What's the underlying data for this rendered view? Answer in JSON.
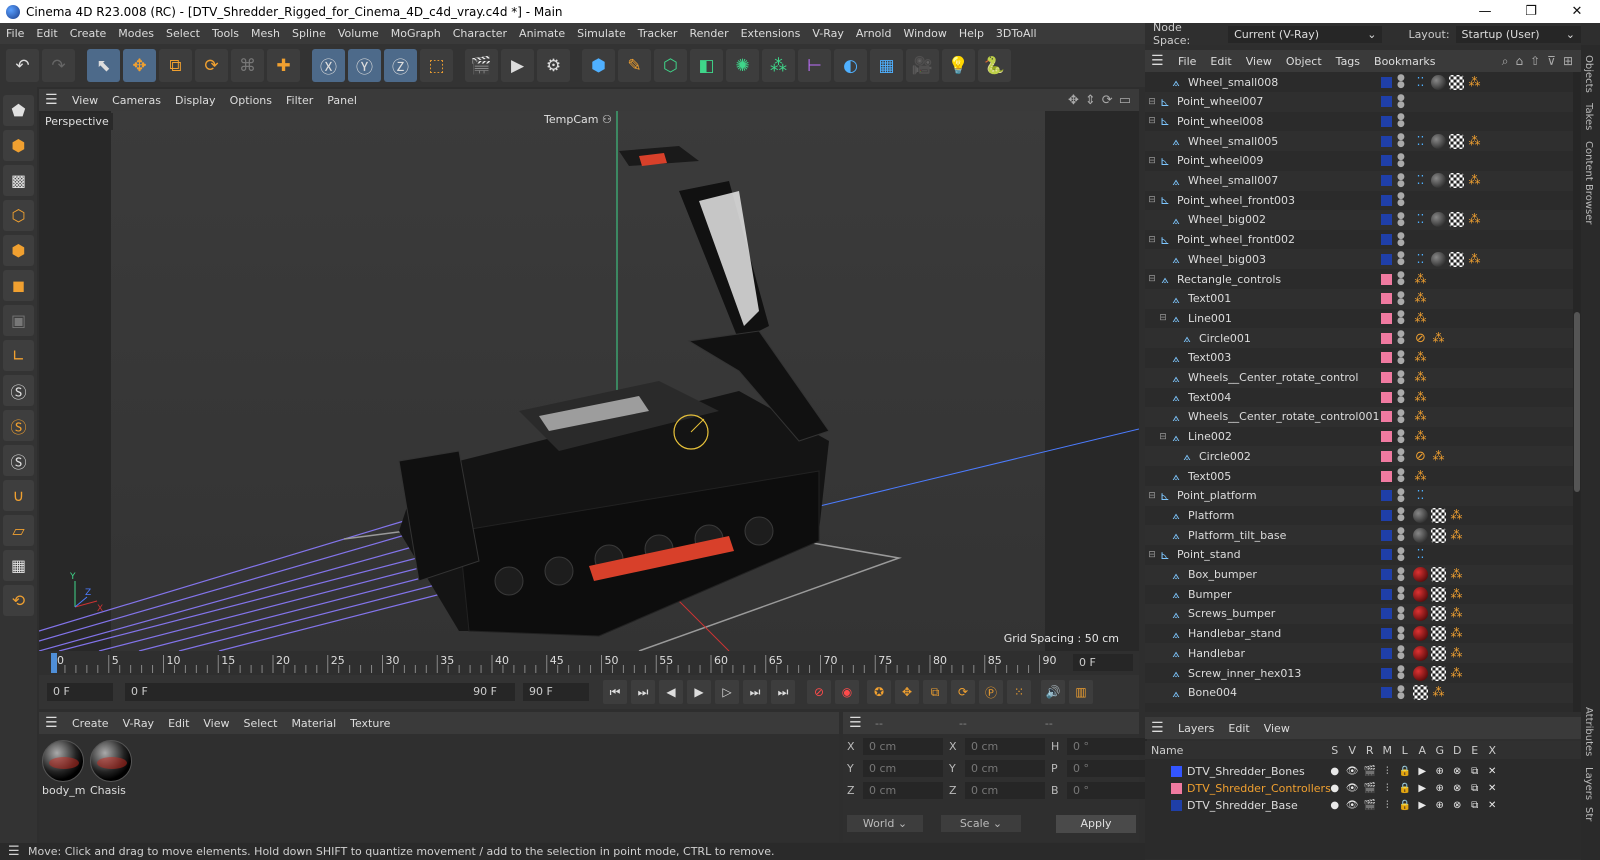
{
  "window": {
    "title": "Cinema 4D R23.008 (RC) - [DTV_Shredder_Rigged_for_Cinema_4D_c4d_vray.c4d *] - Main",
    "minimize": "—",
    "maximize": "❐",
    "close": "✕"
  },
  "menubar": [
    "File",
    "Edit",
    "Create",
    "Modes",
    "Select",
    "Tools",
    "Mesh",
    "Spline",
    "Volume",
    "MoGraph",
    "Character",
    "Animate",
    "Simulate",
    "Tracker",
    "Render",
    "Extensions",
    "V-Ray",
    "Arnold",
    "Window",
    "Help",
    "3DToAll"
  ],
  "right_header": {
    "node_space_label": "Node Space:",
    "node_space_value": "Current (V-Ray)",
    "layout_label": "Layout:",
    "layout_value": "Startup (User)"
  },
  "viewport": {
    "menu": [
      "View",
      "Cameras",
      "Display",
      "Options",
      "Filter",
      "Panel"
    ],
    "label": "Perspective",
    "camera": "TempCam",
    "grid_spacing": "Grid Spacing : 50 cm"
  },
  "timeline": {
    "ticks": [
      "0",
      "5",
      "10",
      "15",
      "20",
      "25",
      "30",
      "35",
      "40",
      "45",
      "50",
      "55",
      "60",
      "65",
      "70",
      "75",
      "80",
      "85",
      "90"
    ],
    "current_frame": "0 F"
  },
  "transport": {
    "start_field": "0 F",
    "range_start": "0 F",
    "range_end": "90 F",
    "end_field": "90 F"
  },
  "materials": {
    "menu": [
      "Create",
      "V-Ray",
      "Edit",
      "View",
      "Select",
      "Material",
      "Texture"
    ],
    "items": [
      {
        "name": "body_ma"
      },
      {
        "name": "Chasis"
      }
    ]
  },
  "coordinates": {
    "header": [
      "--",
      "--",
      "--"
    ],
    "rows": [
      {
        "l1": "X",
        "v1": "0 cm",
        "l2": "X",
        "v2": "0 cm",
        "l3": "H",
        "v3": "0 °"
      },
      {
        "l1": "Y",
        "v1": "0 cm",
        "l2": "Y",
        "v2": "0 cm",
        "l3": "P",
        "v3": "0 °"
      },
      {
        "l1": "Z",
        "v1": "0 cm",
        "l2": "Z",
        "v2": "0 cm",
        "l3": "B",
        "v3": "0 °"
      }
    ],
    "world": "World",
    "scale": "Scale",
    "apply": "Apply"
  },
  "object_manager": {
    "menu": [
      "File",
      "Edit",
      "View",
      "Object",
      "Tags",
      "Bookmarks"
    ],
    "objects": [
      {
        "name": "Wheel_small008",
        "level": 1,
        "fold": false,
        "color": "#1f3fa8",
        "tags": "full"
      },
      {
        "name": "Point_wheel007",
        "level": 0,
        "fold": true,
        "color": "#1f3fa8",
        "tags": "none"
      },
      {
        "name": "Point_wheel008",
        "level": 0,
        "fold": true,
        "color": "#1f3fa8",
        "tags": "none"
      },
      {
        "name": "Wheel_small005",
        "level": 1,
        "fold": false,
        "color": "#1f3fa8",
        "tags": "full"
      },
      {
        "name": "Point_wheel009",
        "level": 0,
        "fold": true,
        "color": "#1f3fa8",
        "tags": "none"
      },
      {
        "name": "Wheel_small007",
        "level": 1,
        "fold": false,
        "color": "#1f3fa8",
        "tags": "full"
      },
      {
        "name": "Point_wheel_front003",
        "level": 0,
        "fold": true,
        "color": "#1f3fa8",
        "tags": "none"
      },
      {
        "name": "Wheel_big002",
        "level": 1,
        "fold": false,
        "color": "#1f3fa8",
        "tags": "full"
      },
      {
        "name": "Point_wheel_front002",
        "level": 0,
        "fold": true,
        "color": "#1f3fa8",
        "tags": "none"
      },
      {
        "name": "Wheel_big003",
        "level": 1,
        "fold": false,
        "color": "#1f3fa8",
        "tags": "full"
      },
      {
        "name": "Rectangle_controls",
        "level": 0,
        "fold": true,
        "color": "#f07aa0",
        "tags": "xp"
      },
      {
        "name": "Text001",
        "level": 1,
        "fold": false,
        "color": "#f07aa0",
        "tags": "xp"
      },
      {
        "name": "Line001",
        "level": 1,
        "fold": true,
        "color": "#f07aa0",
        "tags": "xp"
      },
      {
        "name": "Circle001",
        "level": 2,
        "fold": false,
        "color": "#f07aa0",
        "tags": "rxp"
      },
      {
        "name": "Text003",
        "level": 1,
        "fold": false,
        "color": "#f07aa0",
        "tags": "xp"
      },
      {
        "name": "Wheels__Center_rotate_control",
        "level": 1,
        "fold": false,
        "color": "#f07aa0",
        "tags": "xp"
      },
      {
        "name": "Text004",
        "level": 1,
        "fold": false,
        "color": "#f07aa0",
        "tags": "xp"
      },
      {
        "name": "Wheels__Center_rotate_control001",
        "level": 1,
        "fold": false,
        "color": "#f07aa0",
        "tags": "xp"
      },
      {
        "name": "Line002",
        "level": 1,
        "fold": true,
        "color": "#f07aa0",
        "tags": "xp"
      },
      {
        "name": "Circle002",
        "level": 2,
        "fold": false,
        "color": "#f07aa0",
        "tags": "rxp"
      },
      {
        "name": "Text005",
        "level": 1,
        "fold": false,
        "color": "#f07aa0",
        "tags": "xp"
      },
      {
        "name": "Point_platform",
        "level": 0,
        "fold": true,
        "color": "#1f3fa8",
        "tags": "box"
      },
      {
        "name": "Platform",
        "level": 1,
        "fold": false,
        "color": "#1f3fa8",
        "tags": "mat"
      },
      {
        "name": "Platform_tilt_base",
        "level": 1,
        "fold": false,
        "color": "#1f3fa8",
        "tags": "mat"
      },
      {
        "name": "Point_stand",
        "level": 0,
        "fold": true,
        "color": "#1f3fa8",
        "tags": "box"
      },
      {
        "name": "Box_bumper",
        "level": 1,
        "fold": false,
        "color": "#1f3fa8",
        "tags": "redmat"
      },
      {
        "name": "Bumper",
        "level": 1,
        "fold": false,
        "color": "#1f3fa8",
        "tags": "redmat"
      },
      {
        "name": "Screws_bumper",
        "level": 1,
        "fold": false,
        "color": "#1f3fa8",
        "tags": "redmat"
      },
      {
        "name": "Handlebar_stand",
        "level": 1,
        "fold": false,
        "color": "#1f3fa8",
        "tags": "redmat"
      },
      {
        "name": "Handlebar",
        "level": 1,
        "fold": false,
        "color": "#1f3fa8",
        "tags": "redmat"
      },
      {
        "name": "Screw_inner_hex013",
        "level": 1,
        "fold": false,
        "color": "#1f3fa8",
        "tags": "redmat"
      },
      {
        "name": "Bone004",
        "level": 1,
        "fold": false,
        "color": "#1f3fa8",
        "tags": "chk"
      }
    ]
  },
  "layers": {
    "menu": [
      "Layers",
      "Edit",
      "View"
    ],
    "name_header": "Name",
    "columns": [
      "S",
      "V",
      "R",
      "M",
      "L",
      "A",
      "G",
      "D",
      "E",
      "X"
    ],
    "items": [
      {
        "name": "DTV_Shredder_Bones",
        "color": "#3355ff",
        "highlight": false
      },
      {
        "name": "DTV_Shredder_Controllers",
        "color": "#f07aa0",
        "highlight": true
      },
      {
        "name": "DTV_Shredder_Base",
        "color": "#1f3fa8",
        "highlight": false
      }
    ]
  },
  "side_tabs": [
    "Objects",
    "Takes",
    "Content Browser",
    "Attributes",
    "Layers",
    "Str"
  ],
  "status": "Move: Click and drag to move elements. Hold down SHIFT to quantize movement / add to the selection in point mode, CTRL to remove.",
  "colors": {
    "highlight_text": "#f0a030",
    "accent": "#4d6a8a"
  }
}
